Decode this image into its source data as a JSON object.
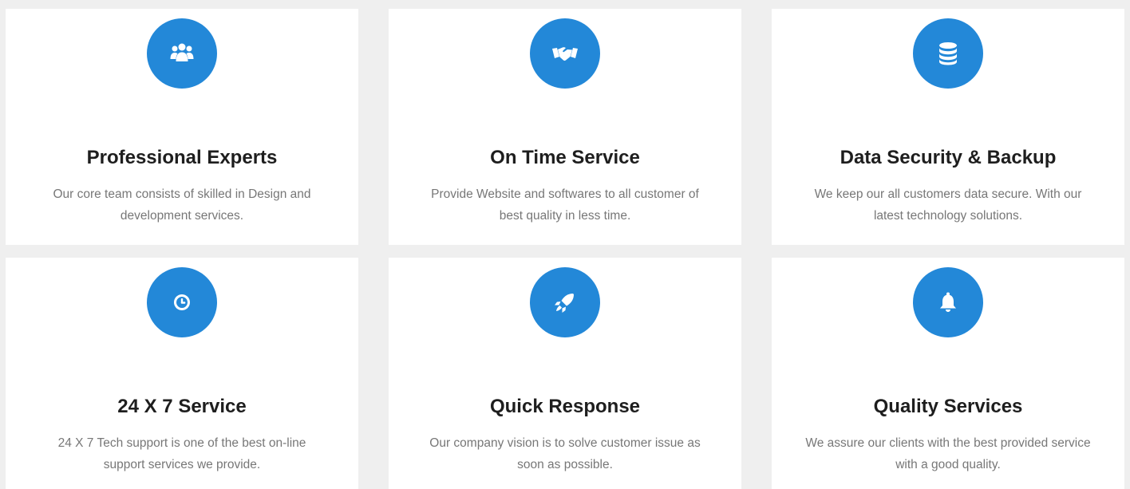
{
  "theme": {
    "accent": "#2388d8",
    "page_background": "#efefef",
    "card_background": "#ffffff",
    "title_color": "#1e1e1e",
    "text_color": "#777777"
  },
  "services": [
    {
      "icon": "users-icon",
      "title": "Professional Experts",
      "description": "Our core team consists of skilled in Design and development services."
    },
    {
      "icon": "handshake-icon",
      "title": "On Time Service",
      "description": "Provide Website and softwares to all customer of best quality in less time."
    },
    {
      "icon": "database-icon",
      "title": "Data Security & Backup",
      "description": "We keep our all customers data secure. With our latest technology solutions."
    },
    {
      "icon": "clock-icon",
      "title": "24 X 7 Service",
      "description": "24 X 7 Tech support is one of the best on-line support services we provide."
    },
    {
      "icon": "rocket-icon",
      "title": "Quick Response",
      "description": "Our company vision is to solve customer issue as soon as possible."
    },
    {
      "icon": "bell-icon",
      "title": "Quality Services",
      "description": "We assure our clients with the best provided service with a good quality."
    }
  ]
}
